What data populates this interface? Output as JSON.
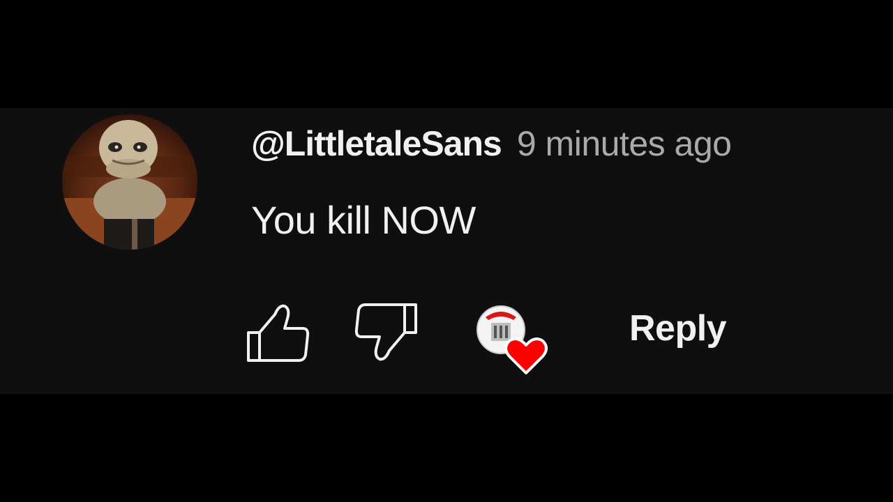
{
  "comment": {
    "author": "@LittletaleSans",
    "timestamp": "9 minutes ago",
    "text": "You kill NOW",
    "avatar_icon": "character-avatar",
    "actions": {
      "like_icon": "thumb-up-icon",
      "dislike_icon": "thumb-down-icon",
      "creator_heart_icon": "creator-heart-icon",
      "reply_label": "Reply"
    }
  },
  "colors": {
    "background": "#000000",
    "card": "#0f0f0f",
    "primary_text": "#f1f1f1",
    "secondary_text": "#aaaaaa",
    "heart": "#ff0000"
  }
}
